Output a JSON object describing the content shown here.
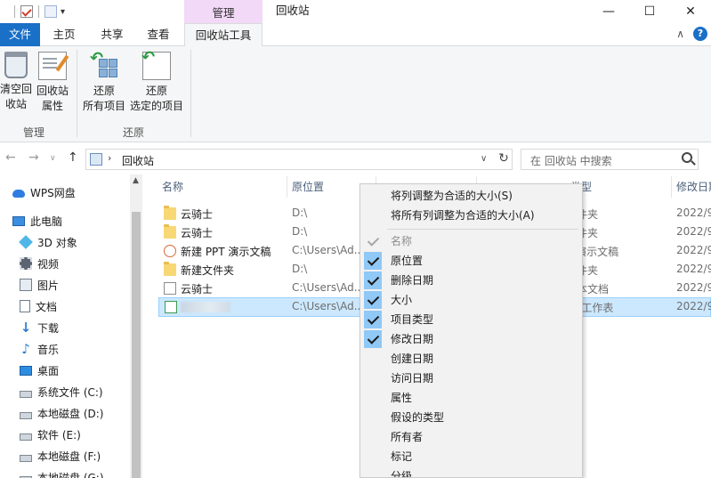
{
  "window": {
    "title": "回收站",
    "context_tab_header": "管理",
    "controls": {
      "minimize": "—",
      "maximize": "☐",
      "close": "✕"
    }
  },
  "ribbon_tabs": [
    {
      "label": "文件"
    },
    {
      "label": "主页"
    },
    {
      "label": "共享"
    },
    {
      "label": "查看"
    },
    {
      "label": "回收站工具"
    }
  ],
  "ribbon": {
    "groups": [
      {
        "label": "管理",
        "buttons": [
          {
            "label_l1": "清空回",
            "label_l2": "收站",
            "icon": "recycle-bin-icon"
          },
          {
            "label_l1": "回收站",
            "label_l2": "属性",
            "icon": "properties-icon"
          }
        ]
      },
      {
        "label": "还原",
        "buttons": [
          {
            "label_l1": "还原",
            "label_l2": "所有项目",
            "icon": "restore-all-icon"
          },
          {
            "label_l1": "还原",
            "label_l2": "选定的项目",
            "icon": "restore-selected-icon"
          }
        ]
      }
    ]
  },
  "address": {
    "path": "回收站",
    "search_placeholder": "在 回收站 中搜索"
  },
  "nav": [
    {
      "label": "WPS网盘",
      "icon": "cloud-icon"
    },
    {
      "label": "此电脑",
      "icon": "computer-icon"
    },
    {
      "label": "3D 对象",
      "icon": "3d-objects-icon"
    },
    {
      "label": "视频",
      "icon": "video-icon"
    },
    {
      "label": "图片",
      "icon": "pictures-icon"
    },
    {
      "label": "文档",
      "icon": "documents-icon"
    },
    {
      "label": "下载",
      "icon": "download-icon"
    },
    {
      "label": "音乐",
      "icon": "music-icon"
    },
    {
      "label": "桌面",
      "icon": "desktop-icon"
    },
    {
      "label": "系统文件 (C:)",
      "icon": "drive-icon"
    },
    {
      "label": "本地磁盘 (D:)",
      "icon": "drive-icon"
    },
    {
      "label": "软件 (E:)",
      "icon": "drive-icon"
    },
    {
      "label": "本地磁盘 (F:)",
      "icon": "drive-icon"
    },
    {
      "label": "本地磁盘 (G:)",
      "icon": "drive-icon"
    }
  ],
  "columns": {
    "name": "名称",
    "location": "原位置",
    "deleted_partial": "删除日期",
    "type": "项目类型",
    "modified": "修改日期"
  },
  "files": [
    {
      "name": "云骑士",
      "location": "D:\\",
      "type": "件夹",
      "modified": "2022/9",
      "icon": "folder-icon"
    },
    {
      "name": "云骑士",
      "location": "D:\\",
      "type": "件夹",
      "modified": "2022/9",
      "icon": "folder-icon"
    },
    {
      "name": "新建 PPT 演示文稿",
      "location": "C:\\Users\\Ad...",
      "type": "T 演示文稿",
      "modified": "2022/9",
      "icon": "ppt-icon"
    },
    {
      "name": "新建文件夹",
      "location": "D:\\",
      "type": "件夹",
      "modified": "2022/9",
      "icon": "folder-icon"
    },
    {
      "name": "云骑士",
      "location": "C:\\Users\\Ad...",
      "type": "本文档",
      "modified": "2022/9",
      "icon": "text-doc-icon"
    },
    {
      "name": "",
      "location": "C:\\Users\\Ad...",
      "type": "S 工作表",
      "modified": "2022/9",
      "icon": "xls-icon",
      "selected": true
    }
  ],
  "context_menu": {
    "size_items": [
      "将列调整为合适的大小(S)",
      "将所有列调整为合适的大小(A)"
    ],
    "column_items": [
      {
        "label": "名称",
        "checked": true,
        "disabled": true
      },
      {
        "label": "原位置",
        "checked": true
      },
      {
        "label": "删除日期",
        "checked": true
      },
      {
        "label": "大小",
        "checked": true
      },
      {
        "label": "项目类型",
        "checked": true
      },
      {
        "label": "修改日期",
        "checked": true
      },
      {
        "label": "创建日期",
        "checked": false
      },
      {
        "label": "访问日期",
        "checked": false
      },
      {
        "label": "属性",
        "checked": false
      },
      {
        "label": "假设的类型",
        "checked": false
      },
      {
        "label": "所有者",
        "checked": false
      },
      {
        "label": "标记",
        "checked": false
      },
      {
        "label": "分级",
        "checked": false
      }
    ]
  },
  "colors": {
    "accent": "#1a6fc7",
    "context_tab": "#f2d9f7",
    "selection": "#cce8ff",
    "menu_check": "#90c8f6"
  }
}
